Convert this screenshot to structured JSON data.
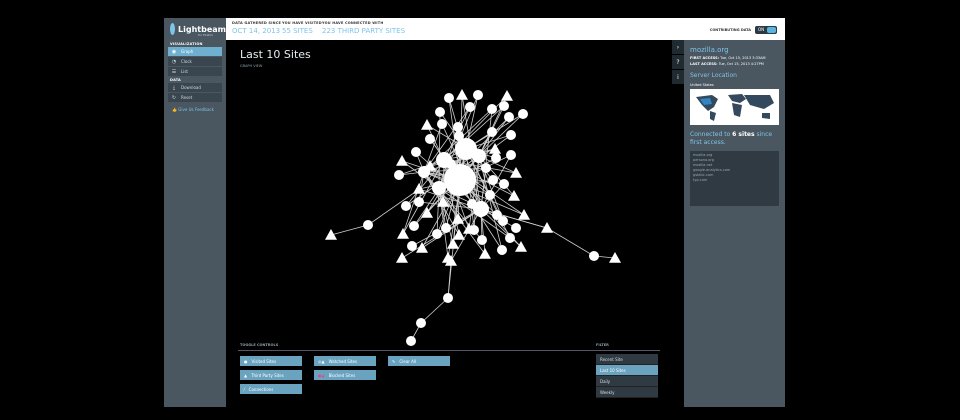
{
  "app": {
    "name": "Lightbeam",
    "sub": "for Firefox"
  },
  "sidebar": {
    "viz_title": "VISUALIZATION",
    "viz_items": [
      {
        "label": "Graph",
        "icon": "graph-icon",
        "active": true
      },
      {
        "label": "Clock",
        "icon": "clock-icon",
        "active": false
      },
      {
        "label": "List",
        "icon": "list-icon",
        "active": false
      }
    ],
    "data_title": "DATA",
    "data_items": [
      {
        "label": "Download",
        "icon": "download-icon"
      },
      {
        "label": "Reset",
        "icon": "reset-icon"
      }
    ],
    "feedback": "Give Us Feedback"
  },
  "topbar": {
    "gathered_label": "DATA GATHERED SINCE",
    "gathered_value": "OCT 14, 2013",
    "visited_label": "YOU HAVE VISITED",
    "visited_value": "55 SITES",
    "connected_label": "YOU HAVE CONNECTED WITH",
    "connected_value": "223 THIRD PARTY SITES",
    "contributing_label": "CONTRIBUTING DATA",
    "toggle_state": "ON"
  },
  "main": {
    "title": "Last 10 Sites",
    "subtitle": "GRAPH VIEW",
    "controls_title": "TOGGLE CONTROLS",
    "filter_title": "FILTER",
    "controls": [
      {
        "label": "Visited Sites",
        "icon": "circle-icon"
      },
      {
        "label": "Watched Sites",
        "icon": "watched-icon"
      },
      {
        "label": "Clear All",
        "icon": "clear-icon"
      },
      {
        "label": "Third Party Sites",
        "icon": "triangle-icon"
      },
      {
        "label": "Blocked Sites",
        "icon": "blocked-icon"
      },
      {
        "label": "Connections",
        "icon": "connections-icon"
      }
    ],
    "filters": [
      {
        "label": "Recent Site",
        "active": false
      },
      {
        "label": "Last 10 Sites",
        "active": true
      },
      {
        "label": "Daily",
        "active": false
      },
      {
        "label": "Weekly",
        "active": false
      }
    ]
  },
  "right_panel": {
    "site": "mozilla.org",
    "first_access_label": "FIRST ACCESS:",
    "first_access": "Tue, Oct 15, 2013 3:33AM",
    "last_access_label": "LAST ACCESS:",
    "last_access": "Tue, Oct 15, 2013 4:27PM",
    "server_location_title": "Server Location",
    "country": "United States",
    "connected_prefix": "Connected to",
    "connected_count": "6 sites",
    "connected_suffix": "since first access.",
    "sites": [
      "mozilla.org",
      "persona.org",
      "mozilla.net",
      "google-analytics.com",
      "gstatic.com",
      "typ.com"
    ]
  },
  "colors": {
    "accent": "#7fc4e6",
    "panel": "#4a5761",
    "button": "#6aa3bf"
  }
}
